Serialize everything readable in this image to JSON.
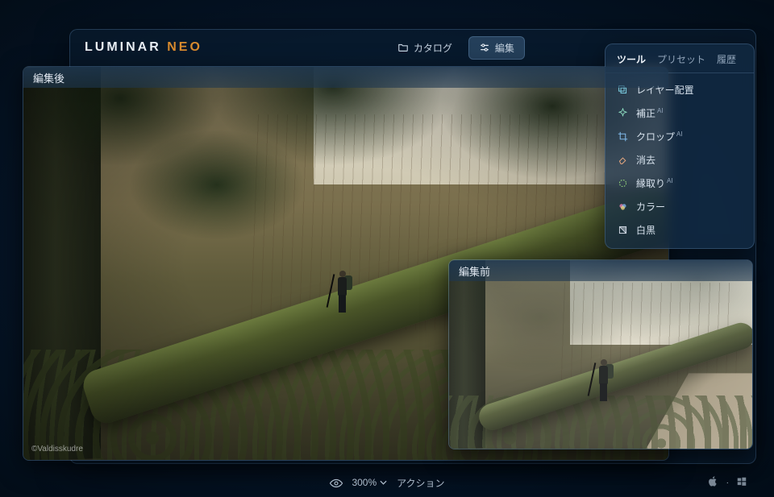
{
  "brand": {
    "word1": "LUMINAR",
    "word2": "NEO"
  },
  "header": {
    "catalog_label": "カタログ",
    "edit_label": "編集"
  },
  "panels": {
    "after_title": "編集後",
    "before_title": "編集前",
    "credit": "©Valdisskudre"
  },
  "tools_panel": {
    "tabs": {
      "tools": "ツール",
      "presets": "プリセット",
      "history": "履歴"
    },
    "items": [
      {
        "icon": "layers",
        "label": "レイヤー配置",
        "ai": false
      },
      {
        "icon": "enhance",
        "label": "補正",
        "ai": true
      },
      {
        "icon": "crop",
        "label": "クロップ",
        "ai": true
      },
      {
        "icon": "erase",
        "label": "消去",
        "ai": false
      },
      {
        "icon": "mask",
        "label": "縁取り",
        "ai": true
      },
      {
        "icon": "color",
        "label": "カラー",
        "ai": false
      },
      {
        "icon": "bw",
        "label": "白黒",
        "ai": false
      }
    ]
  },
  "bottom": {
    "zoom": "300%",
    "action_label": "アクション"
  },
  "colors": {
    "accent": "#d98b2e",
    "panel_border": "rgba(90,130,170,0.4)"
  }
}
